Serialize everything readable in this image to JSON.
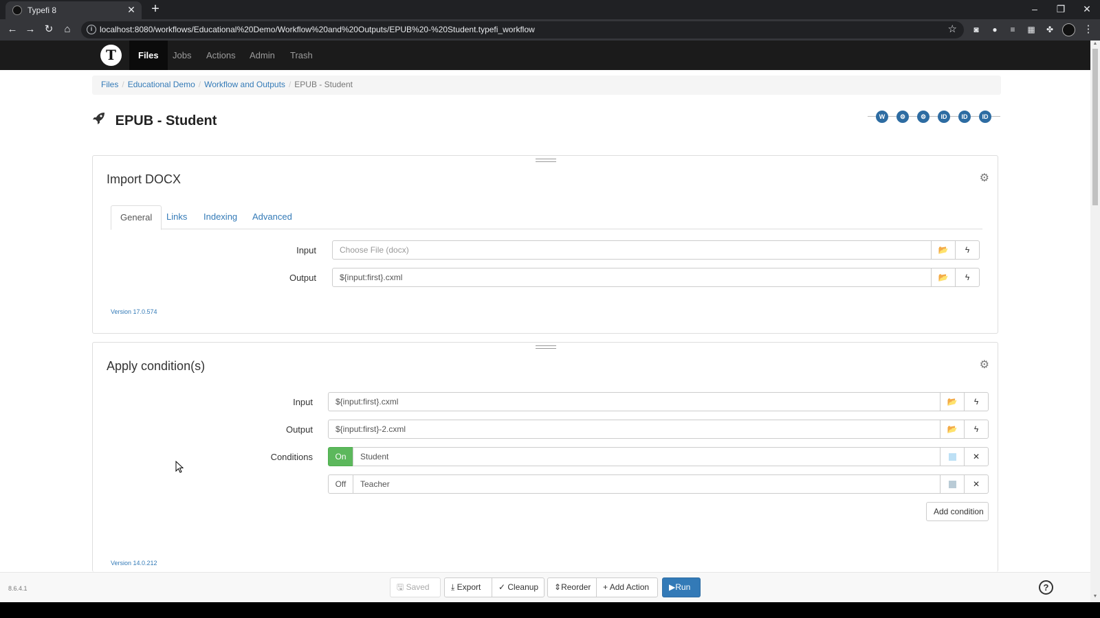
{
  "browser": {
    "tab_title": "Typefi 8",
    "tab_close": "✕",
    "new_tab": "+",
    "url": "localhost:8080/workflows/Educational%20Demo/Workflow%20and%20Outputs/EPUB%20-%20Student.typefi_workflow",
    "controls": {
      "minimize": "–",
      "maximize": "❐",
      "close": "✕"
    },
    "nav": {
      "back": "←",
      "forward": "→",
      "reload": "↻",
      "home": "⌂",
      "star": "☆",
      "menu": "⋮"
    }
  },
  "appnav": {
    "logo_text": "T",
    "items": [
      "Files",
      "Jobs",
      "Actions",
      "Admin",
      "Trash"
    ],
    "active_index": 0
  },
  "breadcrumb": {
    "links": [
      "Files",
      "Educational Demo",
      "Workflow and Outputs"
    ],
    "current": "EPUB - Student",
    "separator": "/"
  },
  "page": {
    "title": "EPUB - Student",
    "title_icon": "rocket-icon"
  },
  "timeline": {
    "nodes": [
      "W",
      "⚙",
      "⚙",
      "ID",
      "ID",
      "ID"
    ]
  },
  "import_docx": {
    "title": "Import DOCX",
    "tabs": [
      "General",
      "Links",
      "Indexing",
      "Advanced"
    ],
    "active_tab": 0,
    "input_label": "Input",
    "input_placeholder": "Choose File  (docx)",
    "output_label": "Output",
    "output_value": "${input:first}.cxml",
    "version": "Version 17.0.574"
  },
  "apply_conditions": {
    "title": "Apply condition(s)",
    "input_label": "Input",
    "input_value": "${input:first}.cxml",
    "output_label": "Output",
    "output_value": "${input:first}-2.cxml",
    "conditions_label": "Conditions",
    "conditions": [
      {
        "state": "On",
        "name": "Student",
        "color": "#bde0f5"
      },
      {
        "state": "Off",
        "name": "Teacher",
        "color": "#b9cbd6"
      }
    ],
    "remove_glyph": "✕",
    "add_condition_label": "Add condition",
    "version": "Version 14.0.212"
  },
  "footer": {
    "app_version": "8.6.4.1",
    "saved": "Saved",
    "export": "Export",
    "cleanup": "Cleanup",
    "reorder": "Reorder",
    "add_action": "Add Action",
    "run": "Run",
    "help": "?"
  },
  "glyphs": {
    "folder": "📂",
    "bolt": "ϟ",
    "gear": "⚙"
  },
  "colors": {
    "navbar_bg": "#1b1b1b",
    "link": "#337ab7",
    "on_toggle": "#5cb85c",
    "run_button": "#337ab7"
  }
}
